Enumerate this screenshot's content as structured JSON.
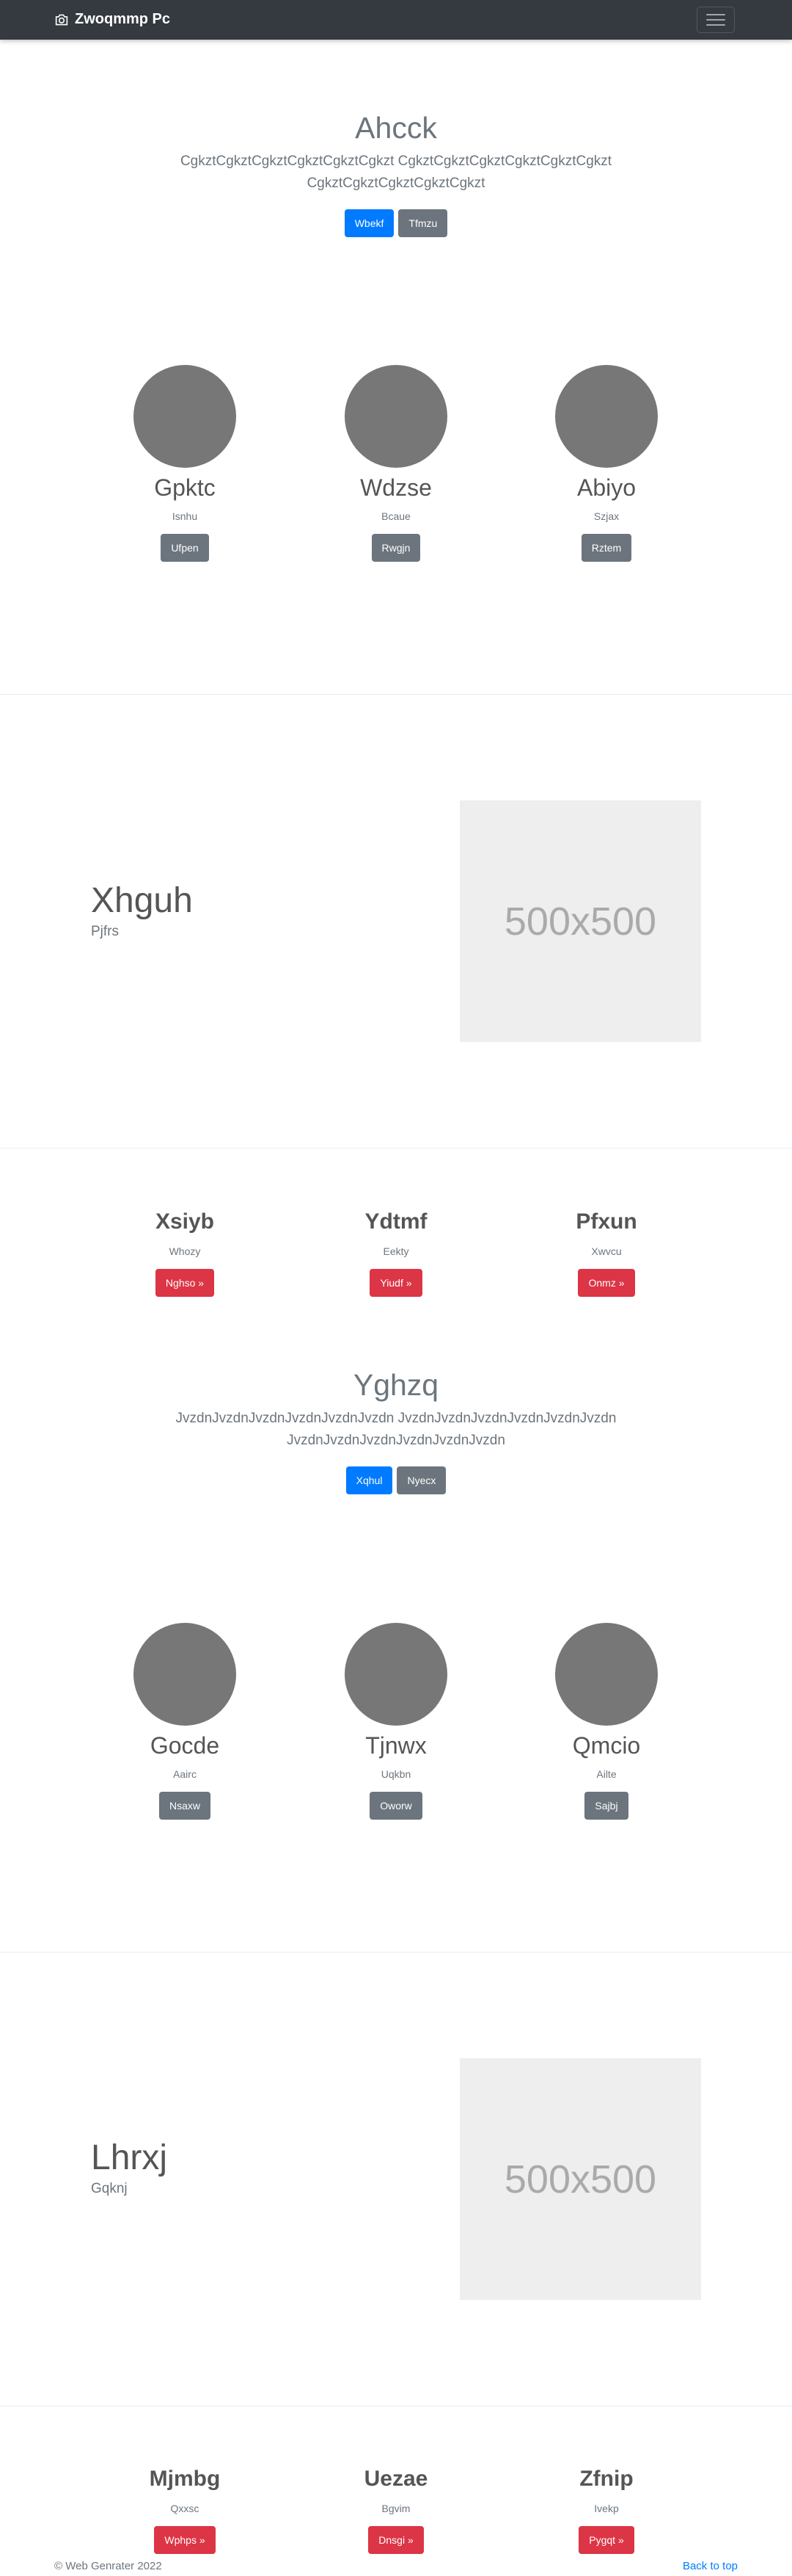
{
  "navbar": {
    "brand": "Zwoqmmp Pc",
    "icon": "camera-icon",
    "menu_icon": "hamburger-icon"
  },
  "jumbotron1": {
    "title": "Ahcck",
    "text": "CgkztCgkztCgkztCgkztCgkztCgkzt CgkztCgkztCgkztCgkztCgkztCgkzt CgkztCgkztCgkztCgkztCgkzt",
    "primary": "Wbekf",
    "secondary": "Tfmzu"
  },
  "team1": [
    {
      "name": "Gpktc",
      "sub": "Isnhu",
      "button": "Ufpen"
    },
    {
      "name": "Wdzse",
      "sub": "Bcaue",
      "button": "Rwgjn"
    },
    {
      "name": "Abiyo",
      "sub": "Szjax",
      "button": "Rztem"
    }
  ],
  "feature1": {
    "title": "Xhguh",
    "sub": "Pjfrs",
    "placeholder": "500x500"
  },
  "columns1": [
    {
      "title": "Xsiyb",
      "sub": "Whozy",
      "button": "Nghso »"
    },
    {
      "title": "Ydtmf",
      "sub": "Eekty",
      "button": "Yiudf »"
    },
    {
      "title": "Pfxun",
      "sub": "Xwvcu",
      "button": "Onmz »"
    }
  ],
  "jumbotron2": {
    "title": "Yghzq",
    "text": "JvzdnJvzdnJvzdnJvzdnJvzdnJvzdn JvzdnJvzdnJvzdnJvzdnJvzdnJvzdn JvzdnJvzdnJvzdnJvzdnJvzdnJvzdn",
    "primary": "Xqhul",
    "secondary": "Nyecx"
  },
  "team2": [
    {
      "name": "Gocde",
      "sub": "Aairc",
      "button": "Nsaxw"
    },
    {
      "name": "Tjnwx",
      "sub": "Uqkbn",
      "button": "Oworw"
    },
    {
      "name": "Qmcio",
      "sub": "Ailte",
      "button": "Sajbj"
    }
  ],
  "feature2": {
    "title": "Lhrxj",
    "sub": "Gqknj",
    "placeholder": "500x500"
  },
  "columns2": [
    {
      "title": "Mjmbg",
      "sub": "Qxxsc",
      "button": "Wphps »"
    },
    {
      "title": "Uezae",
      "sub": "Bgvim",
      "button": "Dnsgi »"
    },
    {
      "title": "Zfnip",
      "sub": "Ivekp",
      "button": "Pygqt »"
    }
  ],
  "footer": {
    "copyright": "© Web Genrater 2022",
    "back_to_top": "Back to top"
  }
}
